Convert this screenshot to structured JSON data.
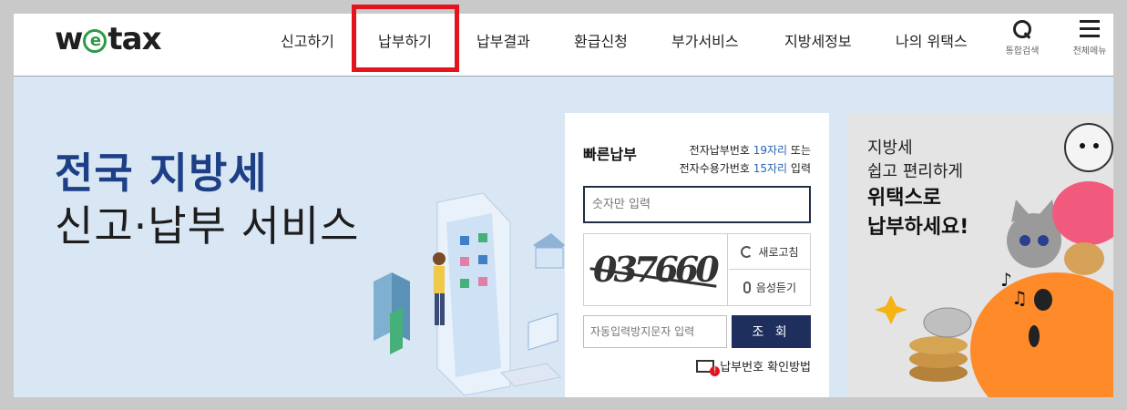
{
  "logo": {
    "prefix": "w",
    "letter": "e",
    "suffix": "tax"
  },
  "nav": [
    {
      "label": "신고하기"
    },
    {
      "label": "납부하기"
    },
    {
      "label": "납부결과"
    },
    {
      "label": "환급신청"
    },
    {
      "label": "부가서비스"
    },
    {
      "label": "지방세정보"
    },
    {
      "label": "나의 위택스"
    }
  ],
  "utility": {
    "search_label": "통합검색",
    "menu_label": "전체메뉴"
  },
  "hero": {
    "line1": "전국 지방세",
    "line2": "신고·납부 서비스"
  },
  "quick_pay": {
    "title": "빠른납부",
    "guide_line1_prefix": "전자납부번호 ",
    "guide_line1_highlight": "19자리",
    "guide_line1_suffix": " 또는",
    "guide_line2_prefix": "전자수용가번호 ",
    "guide_line2_highlight": "15자리",
    "guide_line2_suffix": " 입력",
    "number_placeholder": "숫자만 입력",
    "captcha_text": "037660",
    "refresh_label": "새로고침",
    "voice_label": "음성듣기",
    "captcha_placeholder": "자동입력방지문자 입력",
    "lookup_label": "조 회",
    "howto_label": "납부번호 확인방법"
  },
  "banner": {
    "line1": "지방세",
    "line2": "쉽고 편리하게",
    "line3": "위택스로",
    "line4": "납부하세요!"
  },
  "colors": {
    "accent_navy": "#1e2f5e",
    "hero_blue": "#1d3f86",
    "highlight_red": "#e3141d",
    "logo_green": "#2e9a48"
  }
}
